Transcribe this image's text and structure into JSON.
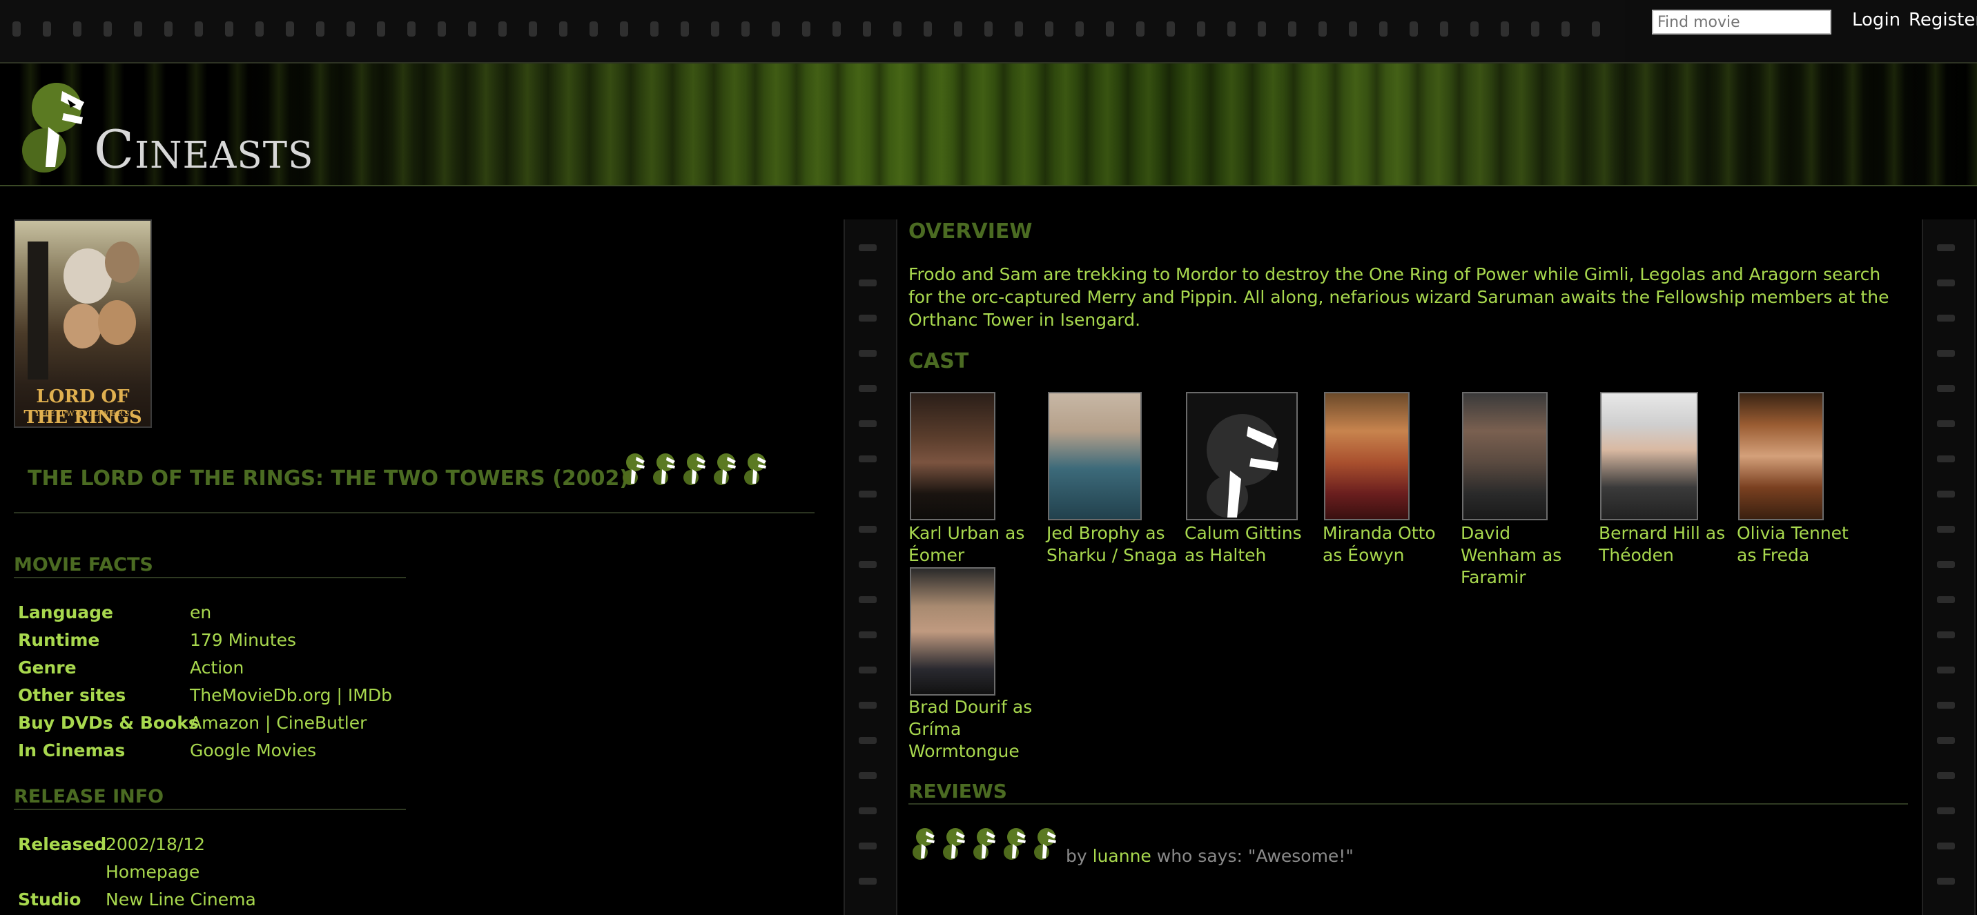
{
  "topbar": {
    "search_placeholder": "Find movie",
    "login": "Login",
    "register": "Register"
  },
  "header": {
    "logo_text": "Cineasts"
  },
  "movie": {
    "title": "THE LORD OF THE RINGS: THE TWO TOWERS (2002)",
    "poster_title": "LORD OF THE RINGS",
    "poster_subtitle": "THE TWO TOWERS",
    "rating": 5
  },
  "facts": {
    "heading": "MOVIE FACTS",
    "rows": [
      {
        "label": "Language",
        "value": "en"
      },
      {
        "label": "Runtime",
        "value": "179 Minutes"
      },
      {
        "label": "Genre",
        "value": "Action"
      },
      {
        "label": "Other sites",
        "value": "TheMovieDb.org | IMDb"
      },
      {
        "label": "Buy DVDs & Books",
        "value": "Amazon | CineButler"
      },
      {
        "label": "In Cinemas",
        "value": "Google Movies"
      }
    ]
  },
  "release": {
    "heading": "RELEASE INFO",
    "rows": [
      {
        "label": "Released",
        "value": "2002/18/12"
      },
      {
        "label": "",
        "value": "Homepage"
      },
      {
        "label": "Studio",
        "value": "New Line Cinema"
      }
    ]
  },
  "overview": {
    "heading": "OVERVIEW",
    "text": "Frodo and Sam are trekking to Mordor to destroy the One Ring of Power while Gimli, Legolas and Aragorn search for the orc-captured Merry and Pippin. All along, nefarious wizard Saruman awaits the Fellowship members at the Orthanc Tower in Isengard."
  },
  "cast": {
    "heading": "CAST",
    "members": [
      {
        "name": "Karl Urban as Éomer"
      },
      {
        "name": "Jed Brophy as Sharku / Snaga"
      },
      {
        "name": "Calum Gittins as Halteh"
      },
      {
        "name": "Miranda Otto as Éowyn"
      },
      {
        "name": "David Wenham as Faramir"
      },
      {
        "name": "Bernard Hill as Théoden"
      },
      {
        "name": "Olivia Tennet as Freda"
      },
      {
        "name": "Brad Dourif as Gríma Wormtongue"
      }
    ]
  },
  "reviews": {
    "heading": "REVIEWS",
    "items": [
      {
        "rating": 5,
        "by": "by",
        "user": "luanne",
        "says": "who says: \"Awesome!\""
      }
    ]
  },
  "colors": {
    "accent": "#a8d84e",
    "heading": "#4b6b22",
    "background": "#000000"
  }
}
